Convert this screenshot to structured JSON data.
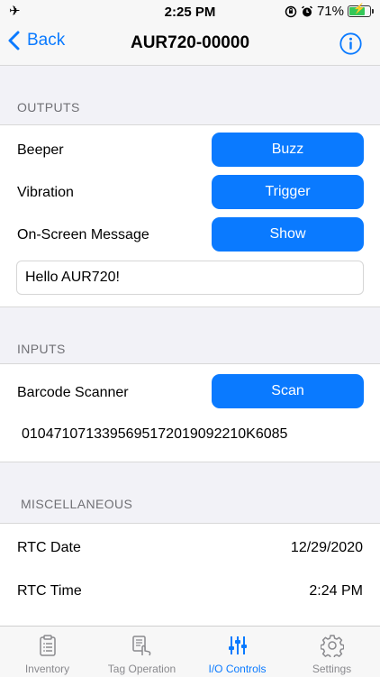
{
  "status_bar": {
    "time": "2:25 PM",
    "battery": "71%"
  },
  "nav": {
    "back_label": "Back",
    "title": "AUR720-00000"
  },
  "outputs": {
    "header": "OUTPUTS",
    "rows": [
      {
        "label": "Beeper",
        "button": "Buzz"
      },
      {
        "label": "Vibration",
        "button": "Trigger"
      },
      {
        "label": "On-Screen Message",
        "button": "Show"
      }
    ],
    "message_value": "Hello AUR720!"
  },
  "inputs": {
    "header": "INPUTS",
    "label": "Barcode Scanner",
    "button": "Scan",
    "scan_value": "0104710713395695172019092210K6085"
  },
  "misc": {
    "header": "MISCELLANEOUS",
    "rows": [
      {
        "label": "RTC Date",
        "value": "12/29/2020"
      },
      {
        "label": "RTC Time",
        "value": "2:24 PM"
      }
    ]
  },
  "tabs": [
    {
      "label": "Inventory",
      "icon": "clipboard-icon"
    },
    {
      "label": "Tag Operation",
      "icon": "tag-operation-icon"
    },
    {
      "label": "I/O Controls",
      "icon": "sliders-icon"
    },
    {
      "label": "Settings",
      "icon": "gear-icon"
    }
  ],
  "colors": {
    "accent": "#0a7aff",
    "battery": "#34c759"
  }
}
